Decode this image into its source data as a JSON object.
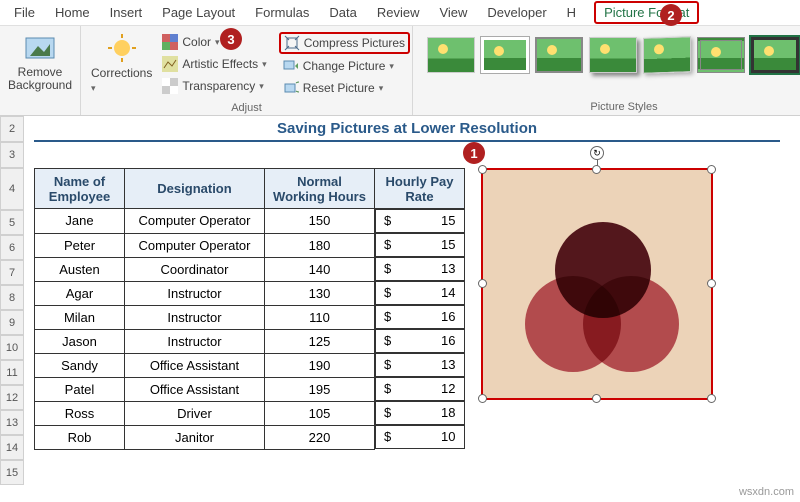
{
  "tabs": [
    "File",
    "Home",
    "Insert",
    "Page Layout",
    "Formulas",
    "Data",
    "Review",
    "View",
    "Developer",
    "H",
    "Picture Format"
  ],
  "active_tab": "Picture Format",
  "ribbon": {
    "remove_bg": "Remove\nBackground",
    "corrections": "Corrections",
    "color": "Color",
    "artistic": "Artistic Effects",
    "transparency": "Transparency",
    "compress": "Compress Pictures",
    "change": "Change Picture",
    "reset": "Reset Picture",
    "group_adjust": "Adjust",
    "group_styles": "Picture Styles"
  },
  "badges": {
    "b1": "1",
    "b2": "2",
    "b3": "3"
  },
  "sheet_title": "Saving Pictures at Lower Resolution",
  "row_numbers": [
    2,
    3,
    4,
    5,
    6,
    7,
    8,
    9,
    10,
    11,
    12,
    13,
    14,
    15
  ],
  "table": {
    "headers": [
      "Name of Employee",
      "Designation",
      "Normal Working Hours",
      "Hourly Pay Rate"
    ],
    "currency": "$",
    "rows": [
      {
        "name": "Jane",
        "desig": "Computer Operator",
        "hours": 150,
        "rate": 15
      },
      {
        "name": "Peter",
        "desig": "Computer Operator",
        "hours": 180,
        "rate": 15
      },
      {
        "name": "Austen",
        "desig": "Coordinator",
        "hours": 140,
        "rate": 13
      },
      {
        "name": "Agar",
        "desig": "Instructor",
        "hours": 130,
        "rate": 14
      },
      {
        "name": "Milan",
        "desig": "Instructor",
        "hours": 110,
        "rate": 16
      },
      {
        "name": "Jason",
        "desig": "Instructor",
        "hours": 125,
        "rate": 16
      },
      {
        "name": "Sandy",
        "desig": "Office Assistant",
        "hours": 190,
        "rate": 13
      },
      {
        "name": "Patel",
        "desig": "Office Assistant",
        "hours": 195,
        "rate": 12
      },
      {
        "name": "Ross",
        "desig": "Driver",
        "hours": 105,
        "rate": 18
      },
      {
        "name": "Rob",
        "desig": "Janitor",
        "hours": 220,
        "rate": 10
      }
    ]
  },
  "watermark": "wsxdn.com"
}
